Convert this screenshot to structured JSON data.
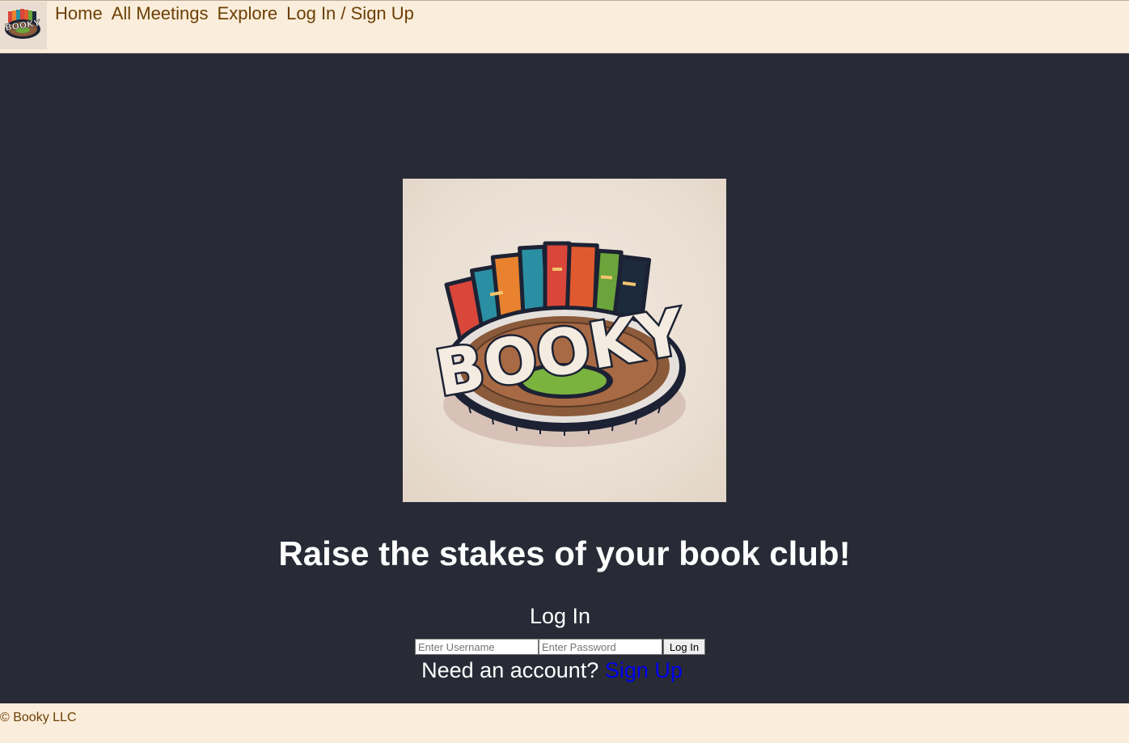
{
  "nav": {
    "logo_alt": "Booky logo",
    "links": [
      "Home",
      "All Meetings",
      "Explore",
      "Log In / Sign Up"
    ]
  },
  "hero": {
    "logo_text": "BOOKY",
    "tagline": "Raise the stakes of your book club!"
  },
  "login": {
    "heading": "Log In",
    "username_placeholder": "Enter Username",
    "password_placeholder": "Enter Password",
    "button_label": "Log In",
    "signup_prompt": "Need an account?",
    "signup_link": "Sign Up"
  },
  "footer": {
    "text": "© Booky LLC"
  },
  "colors": {
    "nav_background": "#fbeddb",
    "link_brown": "#6b3f05",
    "page_background": "#282b36",
    "signup_link_blue": "#0000ee"
  }
}
